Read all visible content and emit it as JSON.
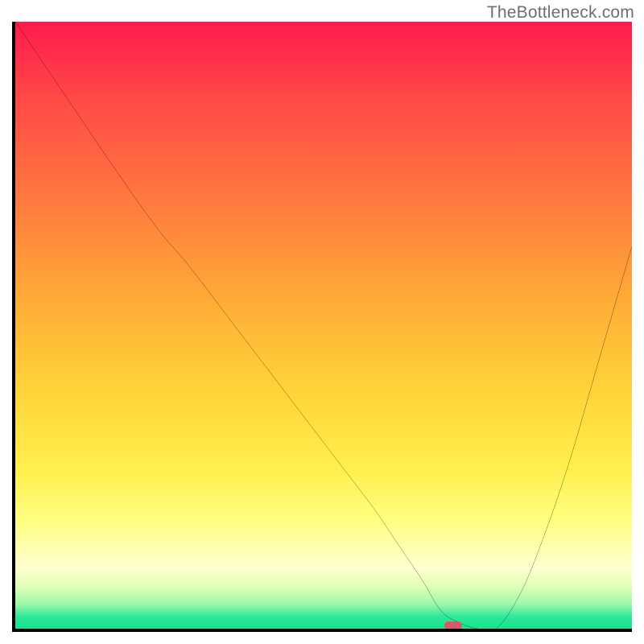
{
  "watermark": "TheBottleneck.com",
  "chart_data": {
    "type": "line",
    "title": "",
    "xlabel": "",
    "ylabel": "",
    "xlim": [
      0,
      100
    ],
    "ylim": [
      0,
      100
    ],
    "x": [
      0,
      8,
      16,
      23,
      28,
      34,
      40,
      46,
      52,
      58,
      62,
      66,
      69,
      72,
      75,
      78,
      82,
      86,
      90,
      94,
      98,
      100
    ],
    "y": [
      100,
      88,
      76,
      66,
      60,
      52,
      44,
      36,
      28,
      20,
      14,
      8,
      3,
      1,
      0,
      0,
      6,
      16,
      28,
      42,
      56,
      63
    ],
    "marker": {
      "x": 71,
      "y": 0.5
    },
    "note": "x and y are in 0–100 plot-area coordinates; y=0 is the bottom axis. Values estimated from pixels."
  }
}
